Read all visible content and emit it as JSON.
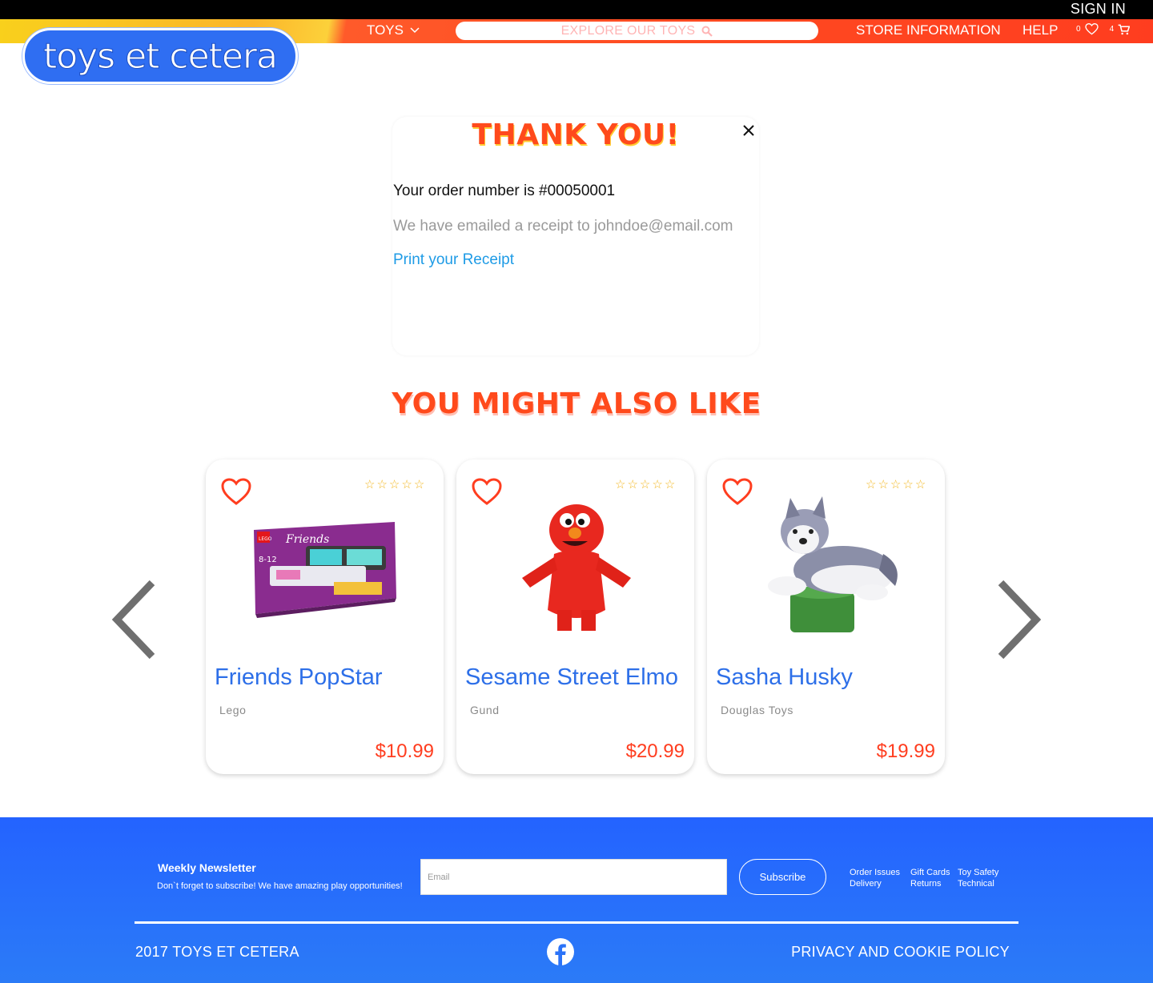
{
  "header": {
    "sign_in": "SIGN IN",
    "nav_toys": "TOYS",
    "search_placeholder": "EXPLORE OUR TOYS",
    "nav_store": "STORE INFORMATION",
    "nav_help": "HELP",
    "wishlist_count": "0",
    "cart_count": "4",
    "logo_text": "toys et cetera"
  },
  "confirmation": {
    "title": "THANK YOU!",
    "order_line": "Your order number is #00050001",
    "email_line": "We have emailed a receipt to johndoe@email.com",
    "print_link": "Print your Receipt"
  },
  "recommendations": {
    "title": "YOU MIGHT ALSO LIKE",
    "products": [
      {
        "name": "Friends PopStar",
        "brand": "Lego",
        "price": "$10.99",
        "rating": 0
      },
      {
        "name": "Sesame Street Elmo",
        "brand": "Gund",
        "price": "$20.99",
        "rating": 0
      },
      {
        "name": "Sasha Husky",
        "brand": "Douglas Toys",
        "price": "$19.99",
        "rating": 0
      }
    ]
  },
  "footer": {
    "newsletter_title": "Weekly Newsletter",
    "newsletter_sub": "Don`t forget to subscribe! We have amazing play opportunities!",
    "email_placeholder": "Email",
    "subscribe": "Subscribe",
    "links": [
      "Order Issues",
      "Delivery",
      "Gift Cards",
      "Returns",
      "Toy Safety",
      "Technical"
    ],
    "copyright": "2017 TOYS ET CETERA",
    "privacy": "PRIVACY AND COOKIE POLICY"
  },
  "colors": {
    "accent_orange": "#ff4a1c",
    "brand_blue": "#2f6ef2",
    "link_blue": "#1e9be6",
    "star_yellow": "#f2b722"
  },
  "icons": [
    "chevron-down-icon",
    "search-icon",
    "heart-icon",
    "cart-icon",
    "close-icon",
    "star-outline-icon",
    "chevron-left-icon",
    "chevron-right-icon",
    "facebook-icon"
  ]
}
